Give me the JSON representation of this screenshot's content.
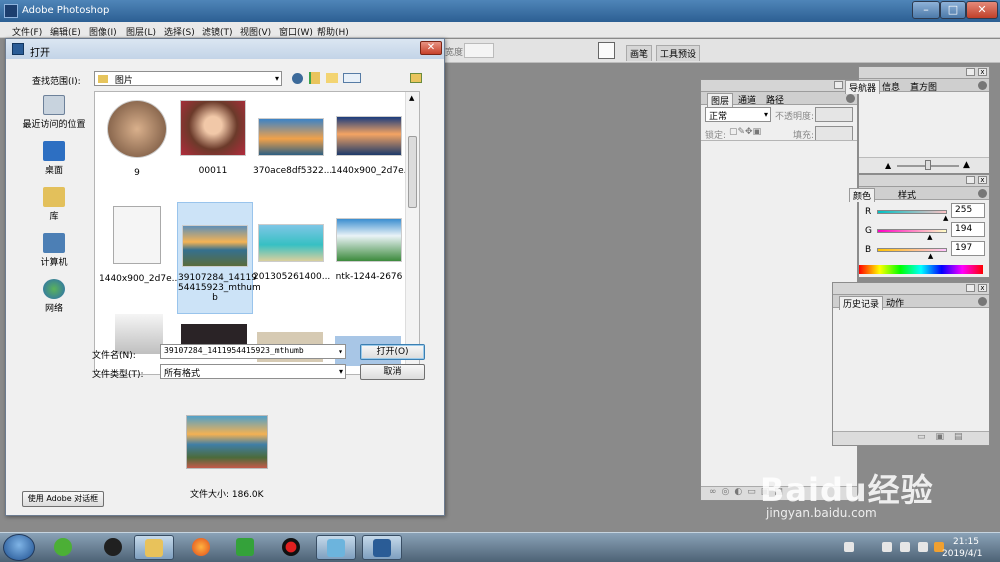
{
  "app": {
    "title": "Adobe Photoshop"
  },
  "menu": [
    "文件(F)",
    "编辑(E)",
    "图像(I)",
    "图层(L)",
    "选择(S)",
    "滤镜(T)",
    "视图(V)",
    "窗口(W)",
    "帮助(H)"
  ],
  "options_bar": {
    "label": "宽度:",
    "tabs": [
      "画笔",
      "工具预设"
    ]
  },
  "layers_panel": {
    "tabs": [
      "图层",
      "通道",
      "路径"
    ],
    "blend_mode": "正常",
    "opacity_label": "不透明度:",
    "lock_label": "锁定:",
    "fill_label": "填充:"
  },
  "navigator_panel": {
    "tabs": [
      "导航器",
      "信息",
      "直方图"
    ]
  },
  "color_panel": {
    "tabs": [
      "颜色",
      "样式"
    ],
    "channels": [
      {
        "label": "R",
        "value": "255",
        "level": 1.0
      },
      {
        "label": "G",
        "value": "194",
        "level": 0.76
      },
      {
        "label": "B",
        "value": "197",
        "level": 0.77
      }
    ]
  },
  "history_panel": {
    "tabs": [
      "历史记录",
      "动作"
    ]
  },
  "open_dialog": {
    "title": "打开",
    "look_in_label": "查找范围(I):",
    "look_in_value": "图片",
    "places": [
      {
        "label": "最近访问的位置",
        "icon": "recent-places-icon"
      },
      {
        "label": "桌面",
        "icon": "desktop-icon"
      },
      {
        "label": "库",
        "icon": "libraries-icon"
      },
      {
        "label": "计算机",
        "icon": "computer-icon"
      },
      {
        "label": "网络",
        "icon": "network-icon"
      }
    ],
    "files": [
      {
        "name": "9"
      },
      {
        "name": "00011"
      },
      {
        "name": "370ace8df5322..."
      },
      {
        "name": "1440x900_2d7e..."
      },
      {
        "name": "1440x900_2d7e..."
      },
      {
        "name": "39107284_14119 54415923_mthum b",
        "selected": true
      },
      {
        "name": "201305261400..."
      },
      {
        "name": "ntk-1244-2676"
      }
    ],
    "filename_label": "文件名(N):",
    "filename_value": "39107284_1411954415923_mthumb",
    "filetype_label": "文件类型(T):",
    "filetype_value": "所有格式",
    "open_button": "打开(O)",
    "cancel_button": "取消",
    "adobe_dialog_button": "使用 Adobe 对话框",
    "file_size": "文件大小: 186.0K"
  },
  "taskbar": {
    "time": "21:15",
    "date": "2019/4/1"
  },
  "watermark": {
    "brand": "Baidu经验",
    "url": "jingyan.baidu.com"
  },
  "colors": {
    "accent": "#2c5f93",
    "selection": "#cce3f7"
  }
}
